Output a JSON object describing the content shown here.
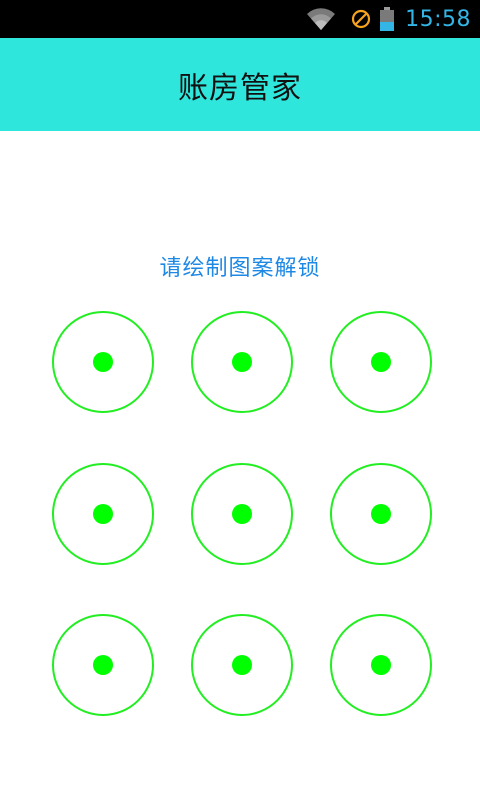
{
  "status_bar": {
    "time": "15:58",
    "icons": [
      "wifi-icon",
      "do-not-disturb-icon",
      "battery-icon"
    ],
    "time_color": "#33b5e5"
  },
  "app_bar": {
    "title": "账房管家",
    "background_color": "#2fe6dd"
  },
  "unlock": {
    "prompt": "请绘制图案解锁",
    "prompt_color": "#1e88e5",
    "grid_rows": 3,
    "grid_cols": 3,
    "node_color": "#00ff00",
    "nodes": [
      "node-1",
      "node-2",
      "node-3",
      "node-4",
      "node-5",
      "node-6",
      "node-7",
      "node-8",
      "node-9"
    ]
  }
}
